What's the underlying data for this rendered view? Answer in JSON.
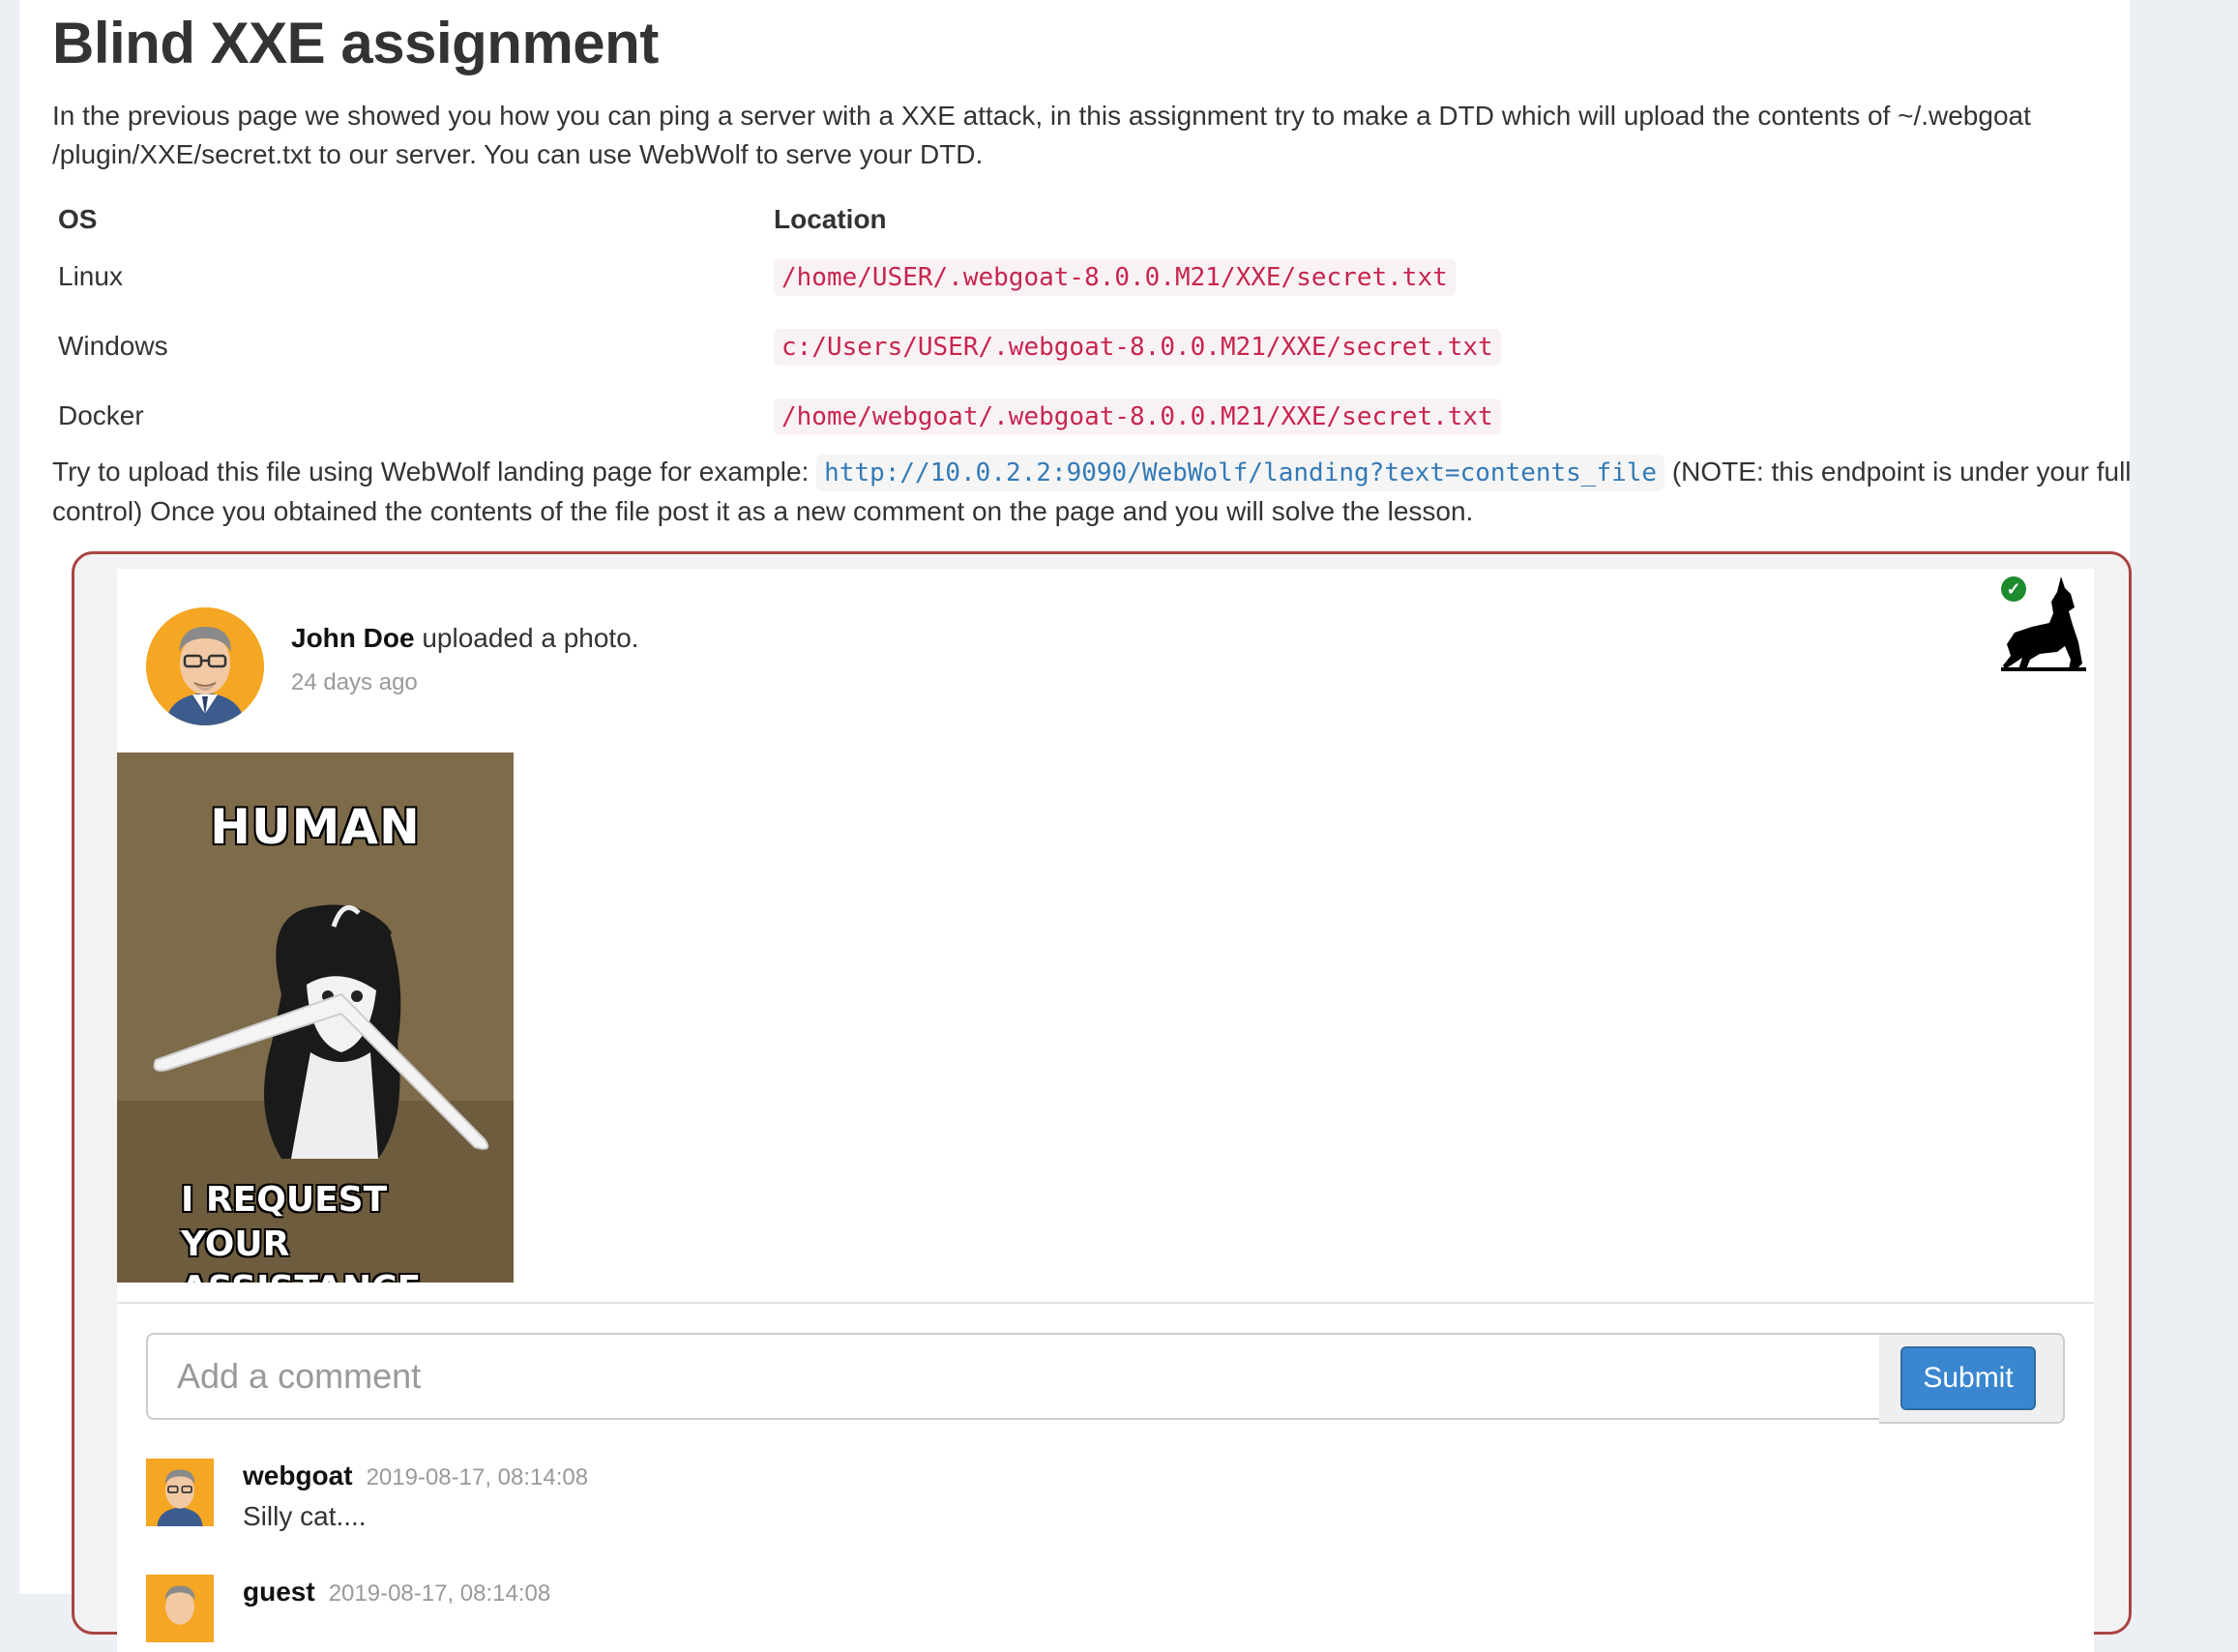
{
  "lesson": {
    "title": "Blind XXE assignment",
    "intro": "In the previous page we showed you how you can ping a server with a XXE attack, in this assignment try to make a DTD which will upload the contents of ~/.webgoat /plugin/XXE/secret.txt to our server. You can use WebWolf to serve your DTD.",
    "table": {
      "headers": [
        "OS",
        "Location"
      ],
      "rows": [
        {
          "os": "Linux",
          "location": "/home/USER/.webgoat-8.0.0.M21/XXE/secret.txt"
        },
        {
          "os": "Windows",
          "location": "c:/Users/USER/.webgoat-8.0.0.M21/XXE/secret.txt"
        },
        {
          "os": "Docker",
          "location": "/home/webgoat/.webgoat-8.0.0.M21/XXE/secret.txt"
        }
      ]
    },
    "try_prefix": "Try to upload this file using WebWolf landing page for example:",
    "try_url": "http://10.0.2.2:9090/WebWolf/landing?text=contents_file",
    "try_suffix": "(NOTE: this endpoint is under your full control) Once you obtained the contents of the file post it as a new comment on the page and you will solve the lesson."
  },
  "post": {
    "author": "John Doe",
    "action": "uploaded a photo.",
    "time": "24 days ago",
    "meme_top": "HUMAN",
    "meme_bottom": "I REQUEST YOUR ASSISTANCE",
    "solved_icon": "check-circle-icon",
    "webwolf_icon": "wolf-icon"
  },
  "comment_form": {
    "placeholder": "Add a comment",
    "submit_label": "Submit"
  },
  "comments": [
    {
      "user": "webgoat",
      "time": "2019-08-17, 08:14:08",
      "text": "Silly cat...."
    },
    {
      "user": "guest",
      "time": "2019-08-17, 08:14:08",
      "text": ""
    }
  ],
  "colors": {
    "accent": "#3a87d0",
    "border_error": "#a94442",
    "code_text": "#c7254e",
    "link_code": "#337ab7"
  }
}
